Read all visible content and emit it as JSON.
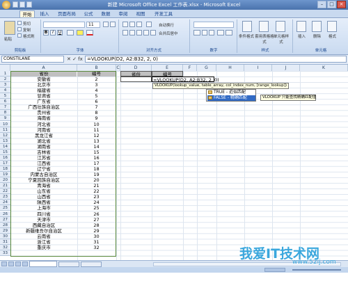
{
  "window": {
    "title": "新建 Microsoft Office Excel 工作表.xlsx - Microsoft Excel",
    "controls": [
      "–",
      "□",
      "×"
    ]
  },
  "ribbon_tabs": [
    "开始",
    "插入",
    "页面布局",
    "公式",
    "数据",
    "审阅",
    "视图",
    "开发工具"
  ],
  "ribbon": {
    "groups": [
      "剪贴板",
      "字体",
      "对齐方式",
      "数字",
      "样式",
      "单元格"
    ],
    "buttons": {
      "cut": "剪切",
      "copy": "复制",
      "paste": "粘贴",
      "format_painter": "格式刷",
      "wrap_text": "自动换行",
      "merge_center": "合并后居中",
      "conditional_format": "条件格式",
      "table_format": "套用表格格式",
      "cell_style": "单元格样式",
      "insert": "插入",
      "delete": "删除",
      "format": "格式"
    },
    "font_size": "11",
    "font_name": ""
  },
  "formula_bar": {
    "name_box": "CONSTILANE",
    "fx": "✕ ✓ fx",
    "formula": "=VLOOKUP(D2, A2:B32, 2, 0)"
  },
  "columns": [
    "A",
    "B",
    "C",
    "D",
    "E",
    "F",
    "G",
    "H",
    "I",
    "J",
    "K"
  ],
  "rows": [
    "1",
    "2",
    "3",
    "4",
    "5",
    "6",
    "7",
    "8",
    "9",
    "10",
    "11",
    "12",
    "13",
    "14",
    "15",
    "16",
    "17",
    "18",
    "19",
    "20",
    "21",
    "22",
    "23",
    "24",
    "25",
    "26",
    "27",
    "28",
    "29",
    "30",
    "31",
    "32",
    "33"
  ],
  "table": {
    "header": {
      "province": "省份",
      "number": "编号"
    },
    "data": [
      {
        "province": "安徽省",
        "number": "2"
      },
      {
        "province": "北京市",
        "number": "3"
      },
      {
        "province": "福建省",
        "number": "4"
      },
      {
        "province": "甘肃省",
        "number": "5"
      },
      {
        "province": "广东省",
        "number": "6"
      },
      {
        "province": "广西壮族自治区",
        "number": "7"
      },
      {
        "province": "贵州省",
        "number": "8"
      },
      {
        "province": "海南省",
        "number": "9"
      },
      {
        "province": "河北省",
        "number": "10"
      },
      {
        "province": "河南省",
        "number": "11"
      },
      {
        "province": "黑龙江省",
        "number": "12"
      },
      {
        "province": "湖北省",
        "number": "13"
      },
      {
        "province": "湖南省",
        "number": "14"
      },
      {
        "province": "吉林省",
        "number": "15"
      },
      {
        "province": "江苏省",
        "number": "16"
      },
      {
        "province": "江西省",
        "number": "17"
      },
      {
        "province": "辽宁省",
        "number": "18"
      },
      {
        "province": "内蒙古自治区",
        "number": "19"
      },
      {
        "province": "宁夏回族自治区",
        "number": "20"
      },
      {
        "province": "青海省",
        "number": "21"
      },
      {
        "province": "山东省",
        "number": "22"
      },
      {
        "province": "山西省",
        "number": "23"
      },
      {
        "province": "陕西省",
        "number": "24"
      },
      {
        "province": "上海市",
        "number": "25"
      },
      {
        "province": "四川省",
        "number": "26"
      },
      {
        "province": "天津市",
        "number": "27"
      },
      {
        "province": "西藏自治区",
        "number": "28"
      },
      {
        "province": "新疆维吾尔自治区",
        "number": "29"
      },
      {
        "province": "云南省",
        "number": "30"
      },
      {
        "province": "浙江省",
        "number": "31"
      },
      {
        "province": "重庆市",
        "number": "32"
      }
    ]
  },
  "lookup": {
    "d1": "省份",
    "e1": "编号",
    "e2": "=VLOOKUP(D2, A2:B32, 2, 0)"
  },
  "tooltip": {
    "signature": "VLOOKUP(lookup_value, table_array, col_index_num, [range_lookup])",
    "options": [
      "TRUE - 近似匹配",
      "FALSE - 精确匹配"
    ],
    "option_help": "VLOOKUP 只能查找精确匹配值"
  },
  "watermark": {
    "text": "我爱IT技术网",
    "url": "www.52ij.com"
  }
}
